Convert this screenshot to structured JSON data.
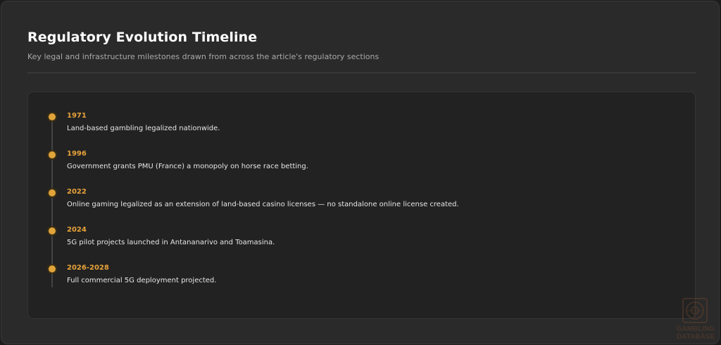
{
  "header": {
    "title": "Regulatory Evolution Timeline",
    "subtitle": "Key legal and infrastructure milestones drawn from across the article's regulatory sections"
  },
  "timeline": {
    "items": [
      {
        "year": "1971",
        "text": "Land-based gambling legalized nationwide."
      },
      {
        "year": "1996",
        "text": "Government grants PMU (France) a monopoly on horse race betting."
      },
      {
        "year": "2022",
        "text": "Online gaming legalized as an extension of land-based casino licenses — no standalone online license created."
      },
      {
        "year": "2024",
        "text": "5G pilot projects launched in Antananarivo and Toamasina."
      },
      {
        "year": "2026-2028",
        "text": "Full commercial 5G deployment projected."
      }
    ]
  },
  "watermark": {
    "text": "GAMBLING DATABASE",
    "icon": "roulette-wheel-icon"
  },
  "colors": {
    "accent": "#e8a33a",
    "background": "#2a2a2a",
    "panel": "#222222"
  }
}
